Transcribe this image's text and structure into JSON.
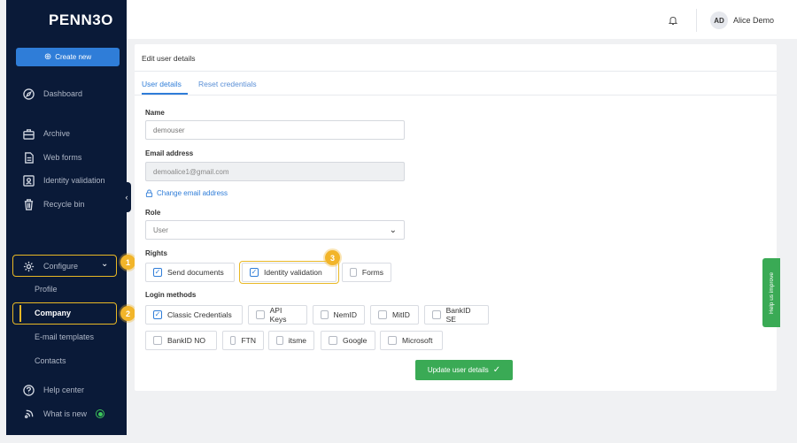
{
  "brand": {
    "logo_text": "PENN3O"
  },
  "sidebar": {
    "create_label": "Create new",
    "items": [
      {
        "label": "Dashboard",
        "icon": "compass-icon"
      },
      {
        "label": "Archive",
        "icon": "archive-icon"
      },
      {
        "label": "Web forms",
        "icon": "document-icon"
      },
      {
        "label": "Identity validation",
        "icon": "id-card-icon"
      },
      {
        "label": "Recycle bin",
        "icon": "trash-icon"
      },
      {
        "label": "Configure",
        "icon": "gear-icon"
      },
      {
        "label": "Help center",
        "icon": "help-circle-icon"
      },
      {
        "label": "What is new",
        "icon": "broadcast-icon"
      }
    ],
    "sub_items": [
      "Profile",
      "Company",
      "E-mail templates",
      "Contacts"
    ]
  },
  "header": {
    "avatar_initials": "AD",
    "username": "Alice Demo"
  },
  "card": {
    "title": "Edit user details",
    "tabs": [
      "User details",
      "Reset credentials"
    ],
    "name_label": "Name",
    "name_value": "demouser",
    "email_label": "Email address",
    "email_value": "demoalice1@gmail.com",
    "change_email": "Change email address",
    "role_label": "Role",
    "role_value": "User",
    "rights_label": "Rights",
    "rights": [
      {
        "label": "Send documents",
        "checked": true
      },
      {
        "label": "Identity validation",
        "checked": true
      },
      {
        "label": "Forms",
        "checked": false
      }
    ],
    "login_label": "Login methods",
    "login_methods": [
      {
        "label": "Classic Credentials",
        "checked": true
      },
      {
        "label": "API Keys",
        "checked": false
      },
      {
        "label": "NemID",
        "checked": false
      },
      {
        "label": "MitID",
        "checked": false
      },
      {
        "label": "BankID SE",
        "checked": false
      },
      {
        "label": "BankID NO",
        "checked": false
      },
      {
        "label": "FTN",
        "checked": false
      },
      {
        "label": "itsme",
        "checked": false
      },
      {
        "label": "Google",
        "checked": false
      },
      {
        "label": "Microsoft",
        "checked": false
      }
    ],
    "update_label": "Update user details"
  },
  "callouts": [
    "1",
    "2",
    "3"
  ],
  "help_tab": "Help us improve",
  "colors": {
    "sidebar": "#0a1a38",
    "accent": "#2f7dd8",
    "highlight": "#e9b825",
    "success": "#3aaa55"
  }
}
